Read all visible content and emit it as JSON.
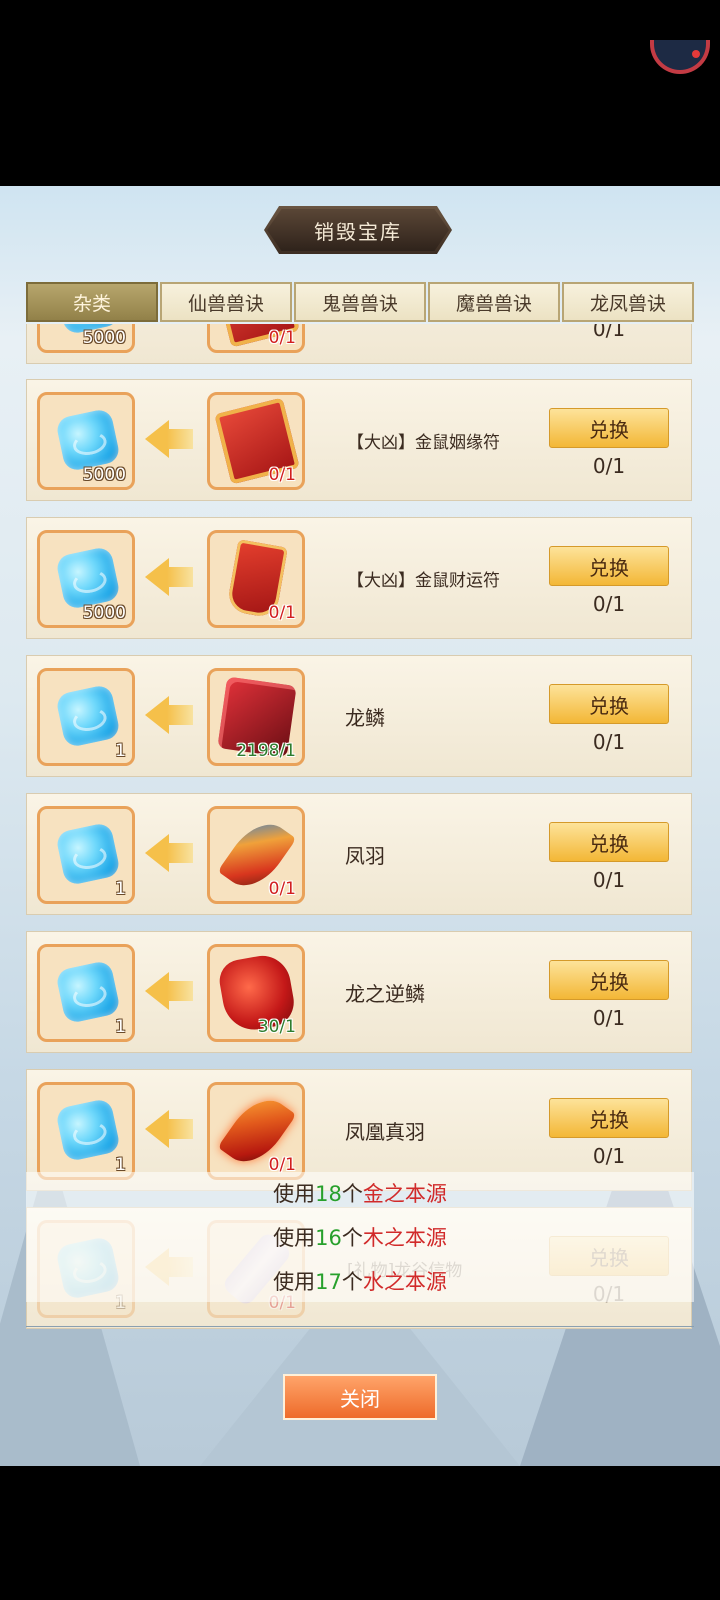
{
  "title": "销毁宝库",
  "tabs": [
    {
      "label": "杂类",
      "active": true
    },
    {
      "label": "仙兽兽诀",
      "active": false
    },
    {
      "label": "鬼兽兽诀",
      "active": false
    },
    {
      "label": "魔兽兽诀",
      "active": false
    },
    {
      "label": "龙凤兽诀",
      "active": false
    }
  ],
  "rows": [
    {
      "cost": "5000",
      "have": "0/1",
      "have_status": "need",
      "name": "",
      "button": "",
      "stock": "0/1"
    },
    {
      "cost": "5000",
      "have": "0/1",
      "have_status": "need",
      "name": "【大凶】金鼠姻缘符",
      "button": "兑换",
      "stock": "0/1"
    },
    {
      "cost": "5000",
      "have": "0/1",
      "have_status": "need",
      "name": "【大凶】金鼠财运符",
      "button": "兑换",
      "stock": "0/1"
    },
    {
      "cost": "1",
      "have": "2198/1",
      "have_status": "ok",
      "name": "龙鳞",
      "button": "兑换",
      "stock": "0/1"
    },
    {
      "cost": "1",
      "have": "0/1",
      "have_status": "need",
      "name": "凤羽",
      "button": "兑换",
      "stock": "0/1"
    },
    {
      "cost": "1",
      "have": "30/1",
      "have_status": "ok",
      "name": "龙之逆鳞",
      "button": "兑换",
      "stock": "0/1"
    },
    {
      "cost": "1",
      "have": "0/1",
      "have_status": "need",
      "name": "凤凰真羽",
      "button": "兑换",
      "stock": "0/1"
    },
    {
      "cost": "1",
      "have": "0/1",
      "have_status": "need",
      "name": "[礼物]龙谷信物",
      "button": "兑换",
      "stock": "0/1"
    }
  ],
  "toasts": [
    {
      "prefix": "使用",
      "number": "18",
      "unit": "个",
      "item": "金之本源"
    },
    {
      "prefix": "使用",
      "number": "16",
      "unit": "个",
      "item": "木之本源"
    },
    {
      "prefix": "使用",
      "number": "17",
      "unit": "个",
      "item": "水之本源"
    }
  ],
  "close_label": "关闭",
  "colors": {
    "need": "#d21f1f",
    "ok": "#2e7d2e",
    "toast_number": "#27a02c",
    "toast_item": "#d12a2a"
  }
}
